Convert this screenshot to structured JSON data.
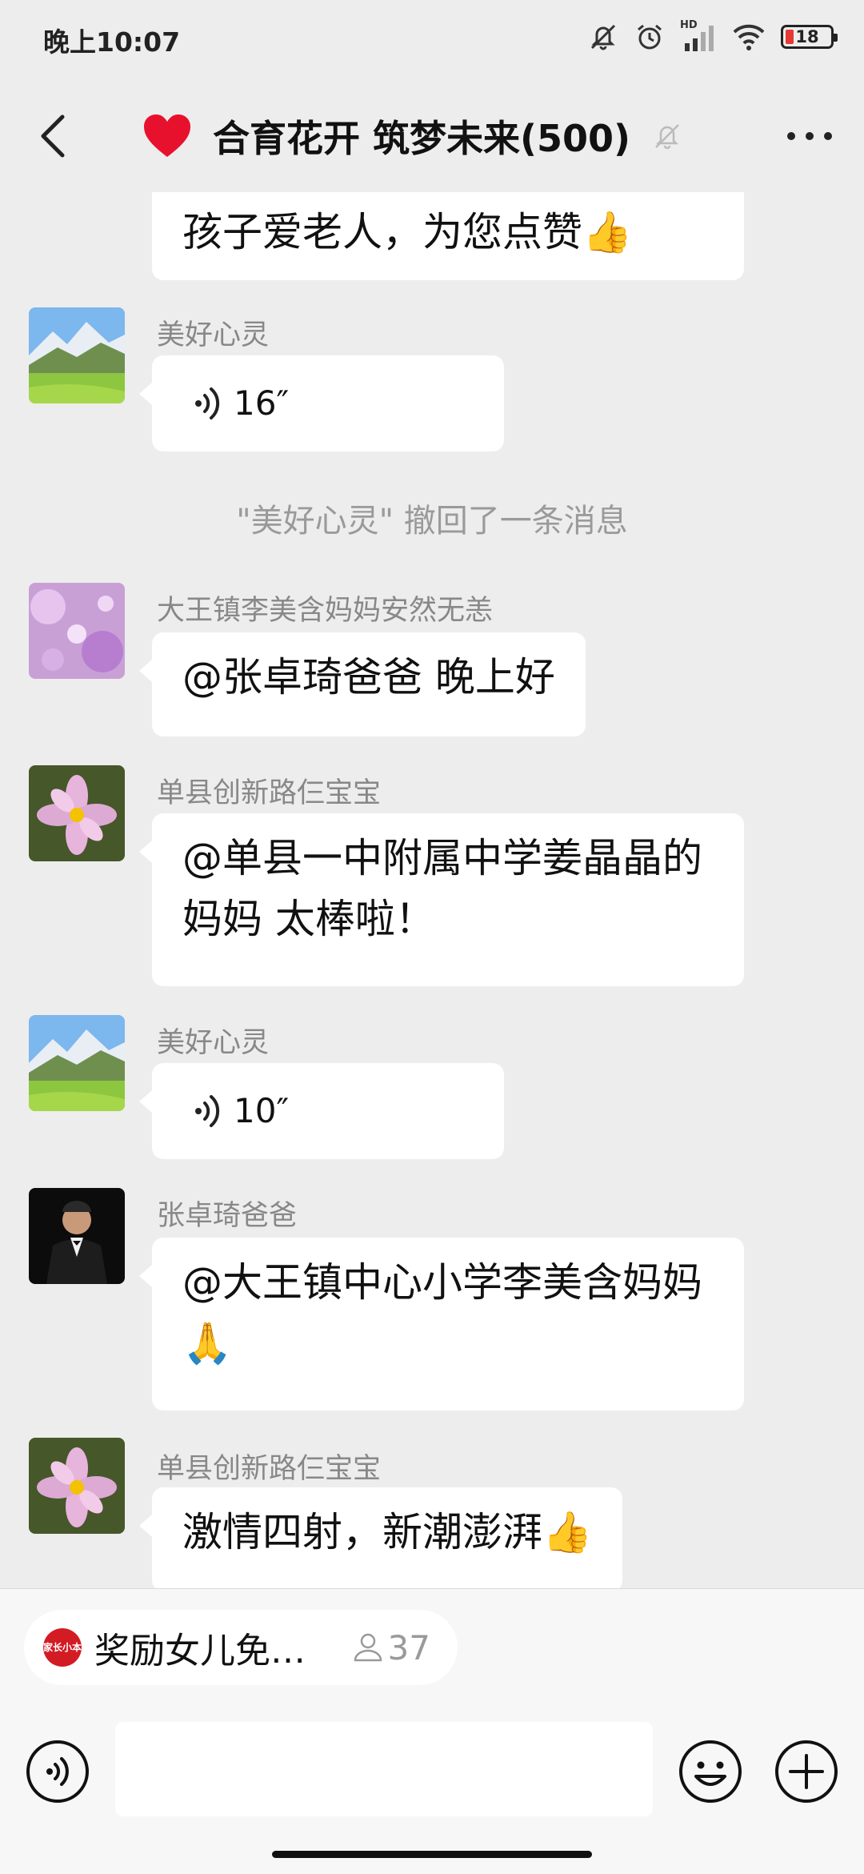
{
  "status_bar": {
    "time": "晚上10:07",
    "hd_label": "HD",
    "battery": "18"
  },
  "header": {
    "title": "合育花开 筑梦未来(500)",
    "heart": "❤️"
  },
  "messages": {
    "partial_text": "孩子爱老人，为您点赞👍",
    "m1": {
      "sender": "美好心灵",
      "duration": "16″"
    },
    "recall_notice": "\"美好心灵\" 撤回了一条消息",
    "m2": {
      "sender": "大王镇李美含妈妈安然无恙",
      "text": "@张卓琦爸爸  晚上好"
    },
    "m3": {
      "sender": "单县创新路仨宝宝",
      "text": "@单县一中附属中学姜晶晶的妈妈  太棒啦！"
    },
    "m4": {
      "sender": "美好心灵",
      "duration": "10″"
    },
    "m5": {
      "sender": "张卓琦爸爸",
      "text": "@大王镇中心小学李美含妈妈  🙏"
    },
    "m6": {
      "sender": "单县创新路仨宝宝",
      "text": "激情四射，新潮澎湃👍"
    }
  },
  "pinned": {
    "logo_text": "家长小本",
    "title": "奖励女儿免…",
    "count": "37"
  },
  "input": {
    "placeholder": ""
  },
  "colors": {
    "background": "#ededed",
    "bubble": "#ffffff",
    "sender_text": "#888888",
    "battery_low": "#e53935",
    "pinned_logo": "#d31b24"
  }
}
